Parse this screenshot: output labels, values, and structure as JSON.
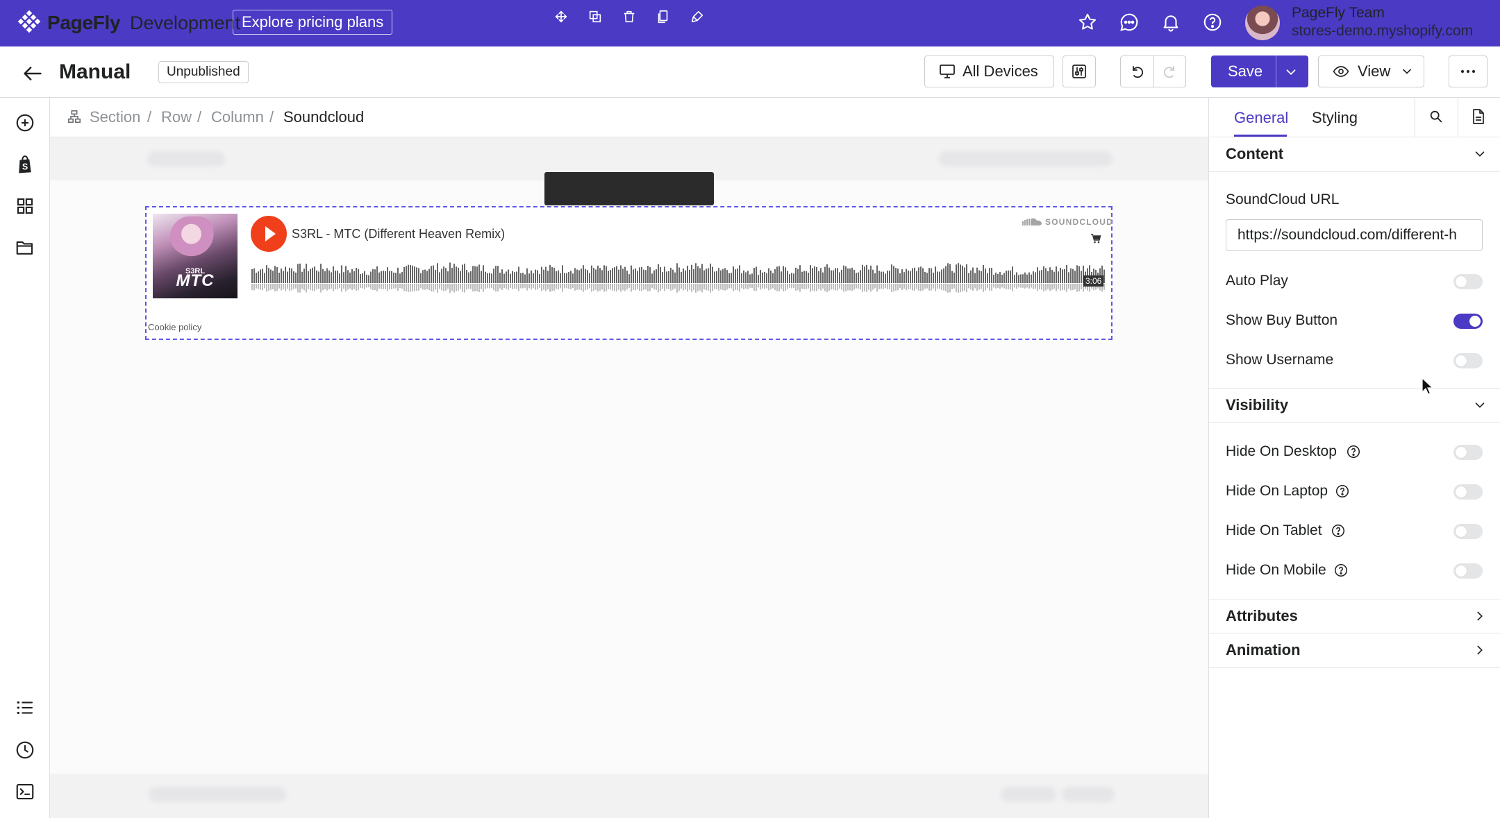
{
  "topbar": {
    "brand": "PageFly",
    "brand_sub": "Development",
    "pricing_label": "Explore pricing plans",
    "user_name": "PageFly Team",
    "store": "stores-demo.myshopify.com",
    "icons": [
      "star-icon",
      "chat-icon",
      "bell-icon",
      "help-icon"
    ]
  },
  "toolbar": {
    "title": "Manual",
    "status": "Unpublished",
    "devices_label": "All Devices",
    "save_label": "Save",
    "view_label": "View"
  },
  "breadcrumb": [
    "Section",
    "Row",
    "Column",
    "Soundcloud"
  ],
  "soundcloud": {
    "track_title": "S3RL - MTC (Different Heaven Remix)",
    "logo_text": "SOUNDCLOUD",
    "duration": "3:06",
    "cookie": "Cookie policy",
    "art_title": "MTC",
    "art_artist": "S3RL"
  },
  "panel": {
    "tabs": [
      "General",
      "Styling"
    ],
    "content": {
      "title": "Content",
      "url_label": "SoundCloud URL",
      "url_value": "https://soundcloud.com/different-h",
      "toggles": [
        {
          "label": "Auto Play",
          "on": false
        },
        {
          "label": "Show Buy Button",
          "on": true
        },
        {
          "label": "Show Username",
          "on": false
        }
      ]
    },
    "visibility": {
      "title": "Visibility",
      "toggles": [
        {
          "label": "Hide On Desktop",
          "on": false
        },
        {
          "label": "Hide On Laptop",
          "on": false
        },
        {
          "label": "Hide On Tablet",
          "on": false
        },
        {
          "label": "Hide On Mobile",
          "on": false
        }
      ]
    },
    "attributes": "Attributes",
    "animation": "Animation"
  },
  "colors": {
    "brand": "#4a3ac4",
    "soundcloud_orange": "#f0401b"
  }
}
